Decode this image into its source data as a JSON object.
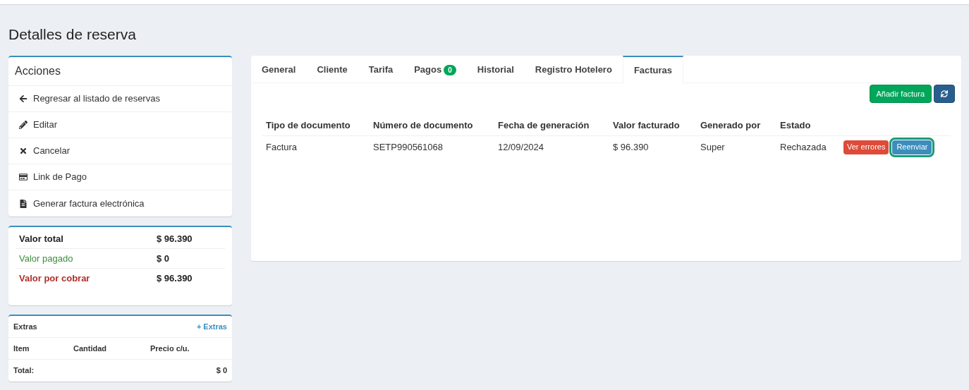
{
  "page_title": "Detalles de reserva",
  "actions": {
    "title": "Acciones",
    "items": [
      {
        "kind": "back",
        "label": "Regresar al listado de reservas"
      },
      {
        "kind": "edit",
        "label": "Editar"
      },
      {
        "kind": "cancel",
        "label": "Cancelar"
      },
      {
        "kind": "payment",
        "label": "Link de Pago"
      },
      {
        "kind": "invoice",
        "label": "Generar factura electrónica"
      }
    ]
  },
  "summary": [
    {
      "kind": "total",
      "label": "Valor total",
      "value": "$ 96.390"
    },
    {
      "kind": "paid",
      "label": "Valor pagado",
      "value": "$ 0"
    },
    {
      "kind": "due",
      "label": "Valor por cobrar",
      "value": "$ 96.390"
    }
  ],
  "extras": {
    "title": "Extras",
    "add_link": "+ Extras",
    "columns": [
      "Item",
      "Cantidad",
      "Precio c/u."
    ],
    "total_label": "Total:",
    "total_value": "$ 0"
  },
  "tabs": [
    {
      "label": "General",
      "selected": false
    },
    {
      "label": "Cliente",
      "selected": false
    },
    {
      "label": "Tarifa",
      "selected": false
    },
    {
      "label": "Pagos",
      "selected": false,
      "badge": "0"
    },
    {
      "label": "Historial",
      "selected": false
    },
    {
      "label": "Registro Hotelero",
      "selected": false
    },
    {
      "label": "Facturas",
      "selected": true
    }
  ],
  "add_invoice_button": "Añadir factura",
  "table": {
    "columns": [
      "Tipo de documento",
      "Número de documento",
      "Fecha de generación",
      "Valor facturado",
      "Generado por",
      "Estado"
    ],
    "rows": [
      {
        "cells": [
          "Factura",
          "SETP990561068",
          "12/09/2024",
          "$ 96.390",
          "Super",
          "Rechazada"
        ],
        "errors_button": "Ver errores",
        "resend_button": {
          "label": "Reenviar",
          "focused": true
        }
      }
    ]
  }
}
